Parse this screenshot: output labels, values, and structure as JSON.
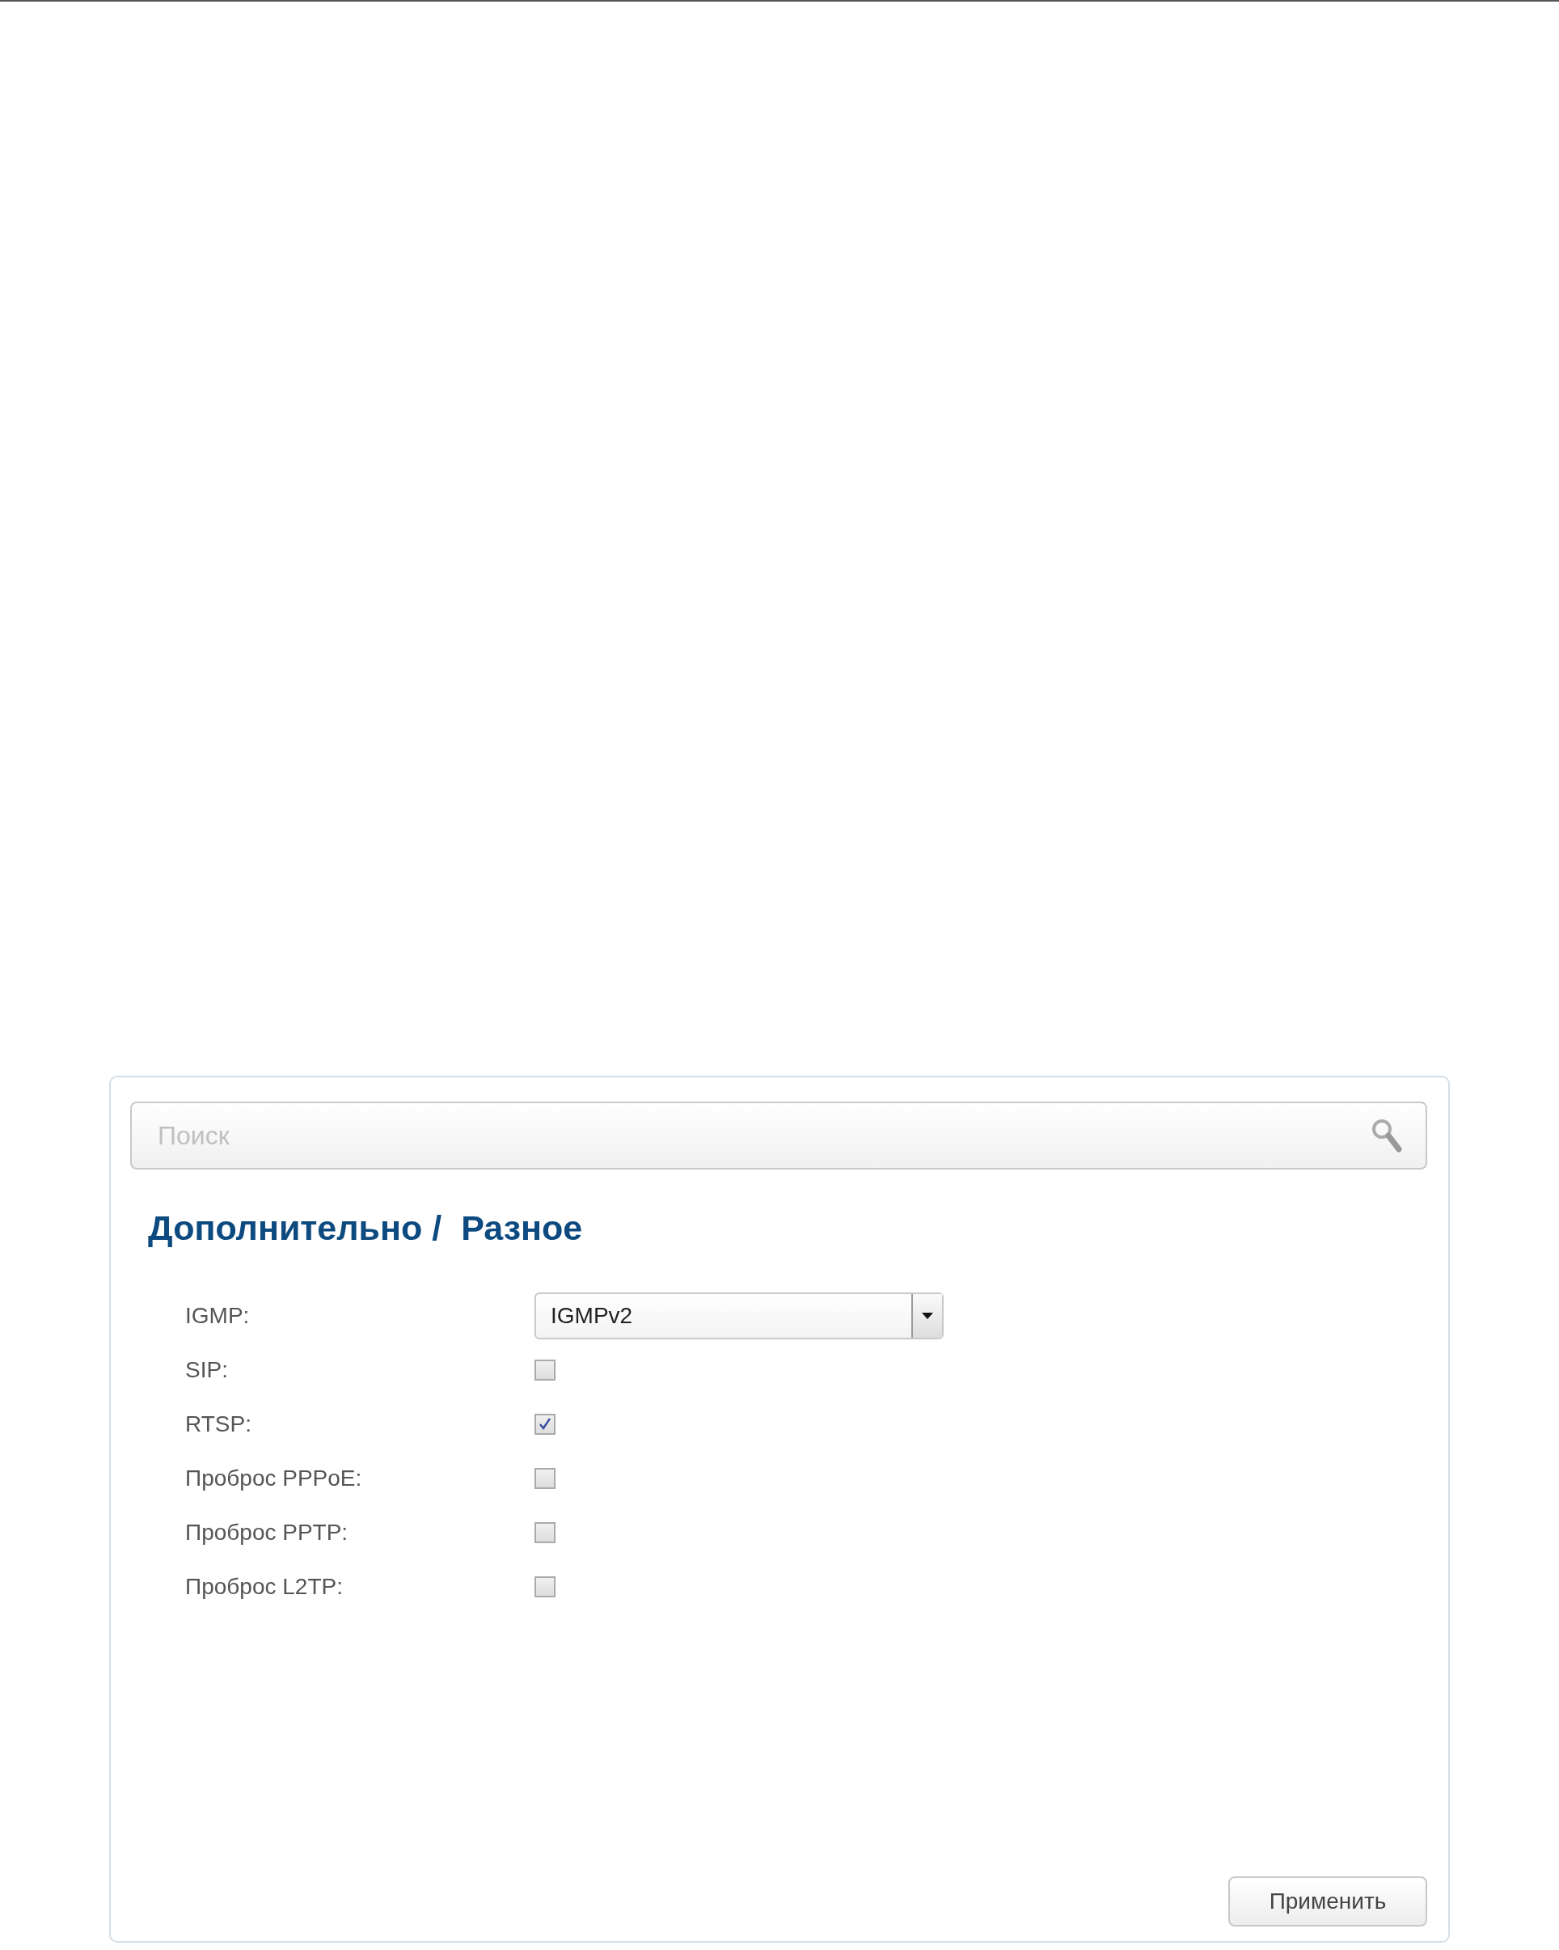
{
  "search": {
    "placeholder": "Поиск"
  },
  "breadcrumb": {
    "section": "Дополнительно /",
    "page": "Разное"
  },
  "fields": [
    {
      "kind": "select",
      "label": "IGMP:",
      "value": "IGMPv2"
    },
    {
      "kind": "checkbox",
      "label": "SIP:",
      "checked": false
    },
    {
      "kind": "checkbox",
      "label": "RTSP:",
      "checked": true
    },
    {
      "kind": "checkbox",
      "label": "Проброс PPPoE:",
      "checked": false
    },
    {
      "kind": "checkbox",
      "label": "Проброс PPTP:",
      "checked": false
    },
    {
      "kind": "checkbox",
      "label": "Проброс L2TP:",
      "checked": false
    }
  ],
  "apply_button": "Применить"
}
